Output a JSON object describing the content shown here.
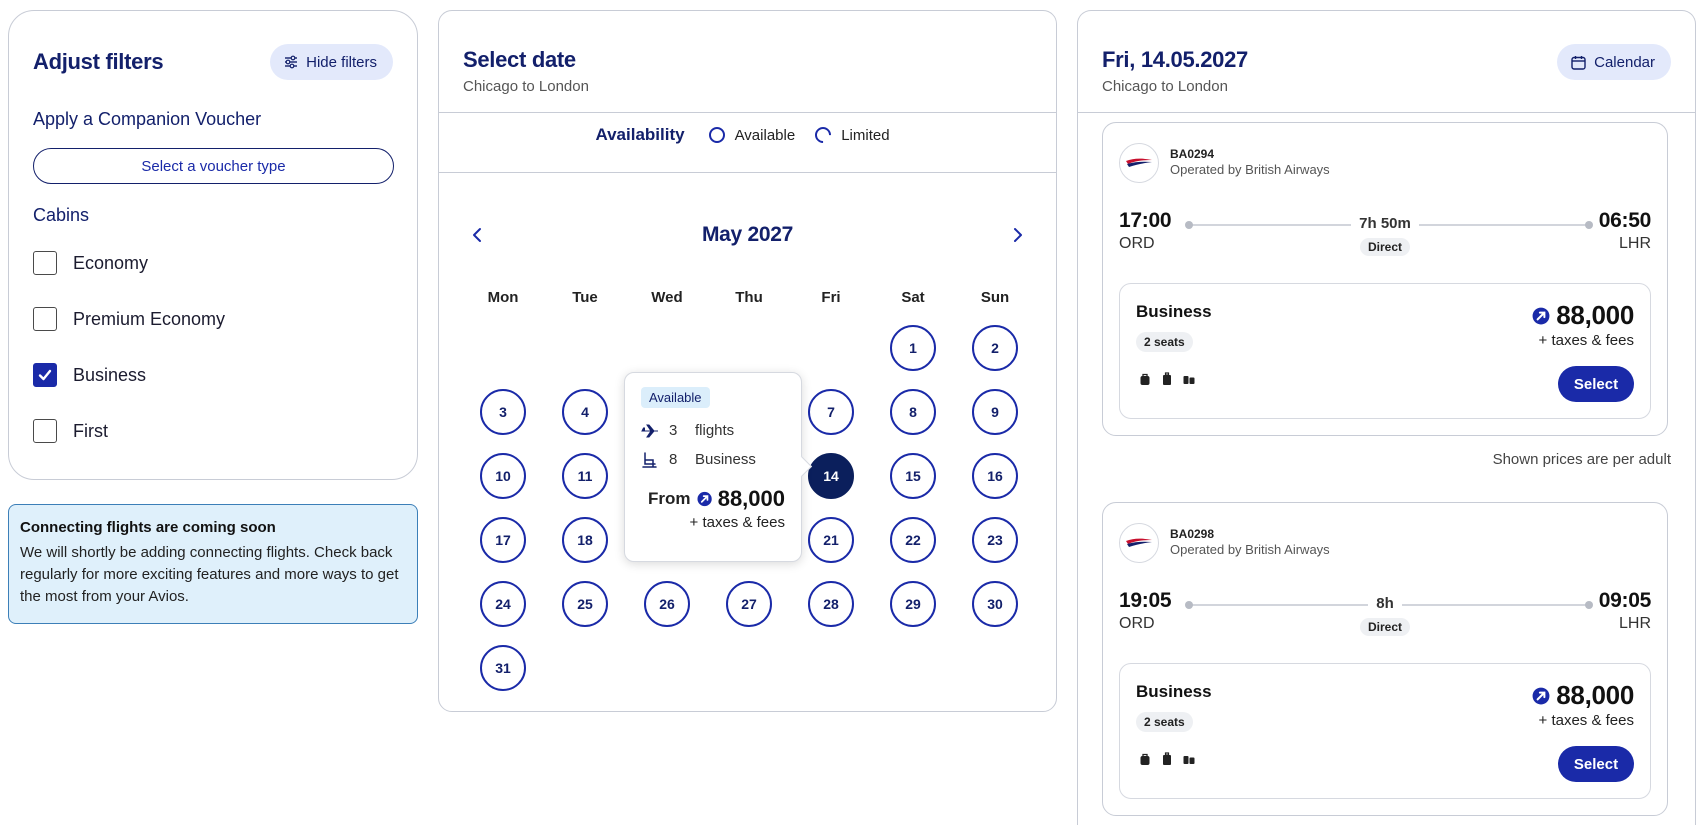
{
  "filters": {
    "title": "Adjust filters",
    "hide_button": "Hide filters",
    "voucher_heading": "Apply a Companion Voucher",
    "voucher_button": "Select a voucher type",
    "cabins_heading": "Cabins",
    "cabins": [
      {
        "label": "Economy",
        "checked": false
      },
      {
        "label": "Premium Economy",
        "checked": false
      },
      {
        "label": "Business",
        "checked": true
      },
      {
        "label": "First",
        "checked": false
      }
    ]
  },
  "notice": {
    "title": "Connecting flights are coming soon",
    "text": "We will shortly be adding connecting flights. Check back regularly for more exciting features and more ways to get the most from your Avios."
  },
  "calendar": {
    "title": "Select date",
    "subtitle": "Chicago to London",
    "availability_label": "Availability",
    "legend_available": "Available",
    "legend_limited": "Limited",
    "month": "May 2027",
    "weekdays": [
      "Mon",
      "Tue",
      "Wed",
      "Thu",
      "Fri",
      "Sat",
      "Sun"
    ],
    "selected_day": "14",
    "tooltip": {
      "badge": "Available",
      "flights_count": "3",
      "flights_label": "flights",
      "seats_count": "8",
      "seats_label": "Business",
      "from_label": "From",
      "price": "88,000",
      "taxes": "+ taxes & fees"
    }
  },
  "flights": {
    "title": "Fri, 14.05.2027",
    "subtitle": "Chicago to London",
    "calendar_button": "Calendar",
    "per_adult_note": "Shown prices are per adult",
    "list": [
      {
        "flight_no": "BA0294",
        "operator": "Operated by British Airways",
        "dep_time": "17:00",
        "dep_airport": "ORD",
        "arr_time": "06:50",
        "arr_airport": "LHR",
        "duration": "7h 50m",
        "stops": "Direct",
        "cabin": "Business",
        "seats": "2 seats",
        "price": "88,000",
        "taxes": "+ taxes & fees",
        "select_label": "Select"
      },
      {
        "flight_no": "BA0298",
        "operator": "Operated by British Airways",
        "dep_time": "19:05",
        "dep_airport": "ORD",
        "arr_time": "09:05",
        "arr_airport": "LHR",
        "duration": "8h",
        "stops": "Direct",
        "cabin": "Business",
        "seats": "2 seats",
        "price": "88,000",
        "taxes": "+ taxes & fees",
        "select_label": "Select"
      }
    ]
  },
  "colors": {
    "brand_navy": "#13206b",
    "accent_blue": "#1a2aa8",
    "selected_day": "#0b1f5c",
    "notice_bg": "#dff0fb"
  }
}
